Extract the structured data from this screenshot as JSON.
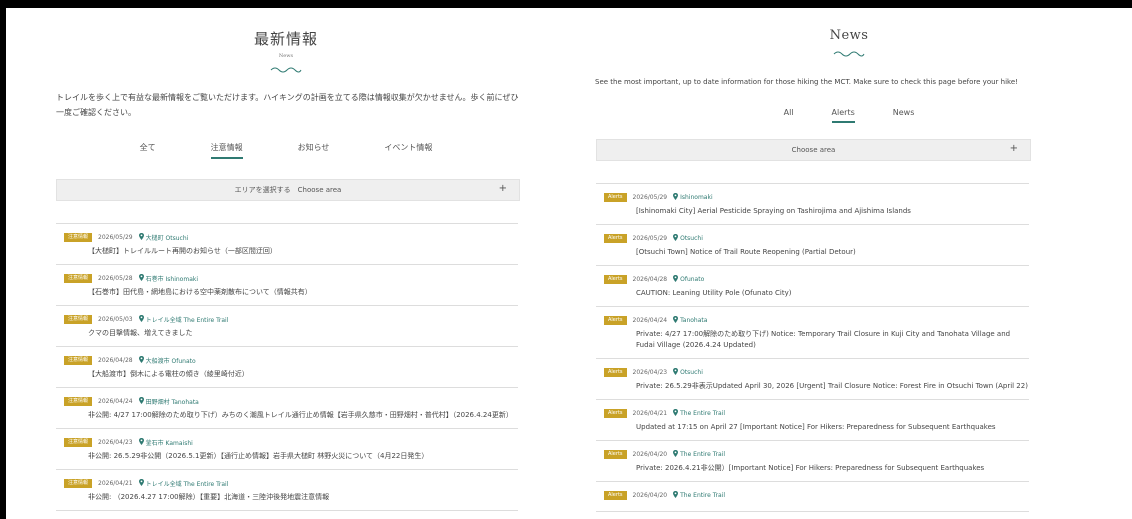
{
  "left": {
    "title": "最新情報",
    "subtitle": "News",
    "intro": "トレイルを歩く上で有益な最新情報をご覧いただけます。ハイキングの計画を立てる際は情報収集が欠かせません。歩く前にぜひ一度ご確認ください。",
    "tabs": [
      "全て",
      "注意情報",
      "お知らせ",
      "イベント情報"
    ],
    "active_tab": 1,
    "area_label": "エリアを選択する　Choose area",
    "area_plus": "+",
    "items": [
      {
        "badge": "注意情報",
        "date": "2026/05/29",
        "location": "大槌町 Otsuchi",
        "headline": "【大槌町】トレイルルート再開のお知らせ（一部区間迂回）"
      },
      {
        "badge": "注意情報",
        "date": "2026/05/28",
        "location": "石巻市 Ishinomaki",
        "headline": "【石巻市】田代島・網地島における空中薬剤散布について（情報共有）"
      },
      {
        "badge": "注意情報",
        "date": "2026/05/03",
        "location": "トレイル全域 The Entire Trail",
        "headline": "クマの目撃情報、増えてきました"
      },
      {
        "badge": "注意情報",
        "date": "2026/04/28",
        "location": "大船渡市 Ofunato",
        "headline": "【大船渡市】倒木による電柱の傾き（綾里崎付近）"
      },
      {
        "badge": "注意情報",
        "date": "2026/04/24",
        "location": "田野畑村 Tanohata",
        "headline": "非公開: 4/27 17:00解除のため取り下げ）みちのく潮風トレイル通行止め情報【岩手県久慈市・田野畑村・普代村】（2026.4.24更新）"
      },
      {
        "badge": "注意情報",
        "date": "2026/04/23",
        "location": "釜石市 Kamaishi",
        "headline": "非公開: 26.5.29非公開（2026.5.1更新）【通行止め情報】岩手県大槌町 林野火災について（4月22日発生）"
      },
      {
        "badge": "注意情報",
        "date": "2026/04/21",
        "location": "トレイル全域 The Entire Trail",
        "headline": "非公開: （2026.4.27 17:00解除）【重要】北海道・三陸沖後発地震注意情報"
      }
    ]
  },
  "right": {
    "title": "News",
    "intro": "See the most important, up to date information for those hiking the MCT. Make sure to check this page before your hike!",
    "tabs": [
      "All",
      "Alerts",
      "News"
    ],
    "active_tab": 1,
    "area_label": "Choose area",
    "area_plus": "+",
    "items": [
      {
        "badge": "Alerts",
        "date": "2026/05/29",
        "location": "Ishinomaki",
        "headline": "[Ishinomaki City] Aerial Pesticide Spraying on Tashirojima and Ajishima Islands"
      },
      {
        "badge": "Alerts",
        "date": "2026/05/29",
        "location": "Otsuchi",
        "headline": "[Otsuchi Town] Notice of Trail Route Reopening (Partial Detour)"
      },
      {
        "badge": "Alerts",
        "date": "2026/04/28",
        "location": "Ofunato",
        "headline": "CAUTION: Leaning Utility Pole (Ofunato City)"
      },
      {
        "badge": "Alerts",
        "date": "2026/04/24",
        "location": "Tanohata",
        "headline": "Private: 4/27 17:00解除のため取り下げ) Notice: Temporary Trail Closure in Kuji City and Tanohata Village and Fudai Village (2026.4.24 Updated)"
      },
      {
        "badge": "Alerts",
        "date": "2026/04/23",
        "location": "Otsuchi",
        "headline": "Private: 26.5.29非表示Updated April 30, 2026 [Urgent] Trail Closure Notice: Forest Fire in Otsuchi Town (April 22)"
      },
      {
        "badge": "Alerts",
        "date": "2026/04/21",
        "location": "The Entire Trail",
        "headline": "Updated at 17:15 on April 27 [Important Notice] For Hikers: Preparedness for Subsequent Earthquakes"
      },
      {
        "badge": "Alerts",
        "date": "2026/04/20",
        "location": "The Entire Trail",
        "headline": "Private: 2026.4.21非公開）[Important Notice] For Hikers: Preparedness for Subsequent Earthquakes"
      },
      {
        "badge": "Alerts",
        "date": "2026/04/20",
        "location": "The Entire Trail",
        "headline": ""
      }
    ]
  },
  "colors": {
    "accent": "#2f7a72",
    "badge": "#c9a227",
    "area_bg": "#efefef"
  },
  "icons": {
    "location": "map-pin-icon",
    "decor": "wave-ornament-icon",
    "expand": "plus-icon"
  }
}
